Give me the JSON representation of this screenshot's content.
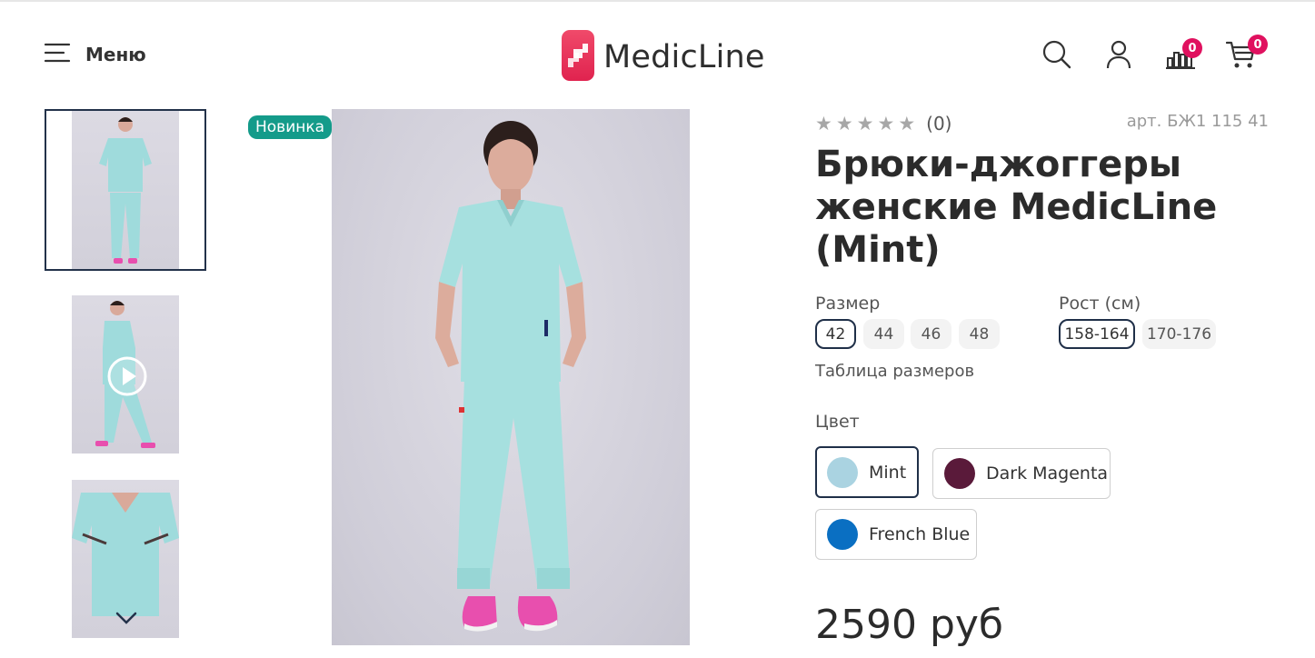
{
  "header": {
    "menu_label": "Меню",
    "logo_text": "MedicLine",
    "compare_count": "0",
    "cart_count": "0",
    "brand_color": "#e8345c"
  },
  "gallery": {
    "badge": "Новинка",
    "thumbnails": [
      {
        "name": "thumb-front",
        "active": true
      },
      {
        "name": "thumb-side-video",
        "video": true
      },
      {
        "name": "thumb-closeup"
      }
    ]
  },
  "product": {
    "rating_count": "(0)",
    "sku": "арт. БЖ1 115 41",
    "title": "Брюки-джоггеры женские MedicLine (Mint)",
    "size_label": "Размер",
    "sizes": [
      "42",
      "44",
      "46",
      "48"
    ],
    "selected_size": "42",
    "height_label": "Рост (см)",
    "heights": [
      "158-164",
      "170-176"
    ],
    "selected_height": "158-164",
    "size_table_link": "Таблица размеров",
    "color_label": "Цвет",
    "colors": [
      {
        "name": "Mint",
        "hex": "#aad3e1",
        "selected": true
      },
      {
        "name": "Dark Magenta",
        "hex": "#5a1a3a",
        "selected": false
      },
      {
        "name": "French Blue",
        "hex": "#0a6fc2",
        "selected": false
      }
    ],
    "price": "2590 руб"
  }
}
